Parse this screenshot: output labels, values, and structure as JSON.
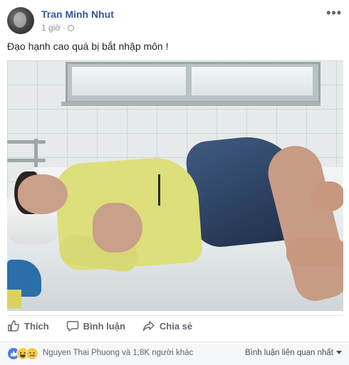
{
  "post": {
    "author_name": "Tran Minh Nhut",
    "timestamp": "1 giờ",
    "separator": "·",
    "privacy_icon": "globe-icon",
    "more_menu": "•••",
    "caption": "Đạo hạnh cao quá bị bắt nhập môn !"
  },
  "actions": {
    "like_label": "Thích",
    "comment_label": "Bình luận",
    "share_label": "Chia sẻ"
  },
  "reactions": {
    "types": [
      "like-icon",
      "haha-icon",
      "sad-icon"
    ],
    "summary": "Nguyen Thai Phuong và 1,8K người khác",
    "comment_sort": "Bình luận liên quan nhất"
  },
  "colors": {
    "link_blue": "#365899",
    "muted_gray": "#90949c",
    "like_blue": "#4a7ddb"
  }
}
